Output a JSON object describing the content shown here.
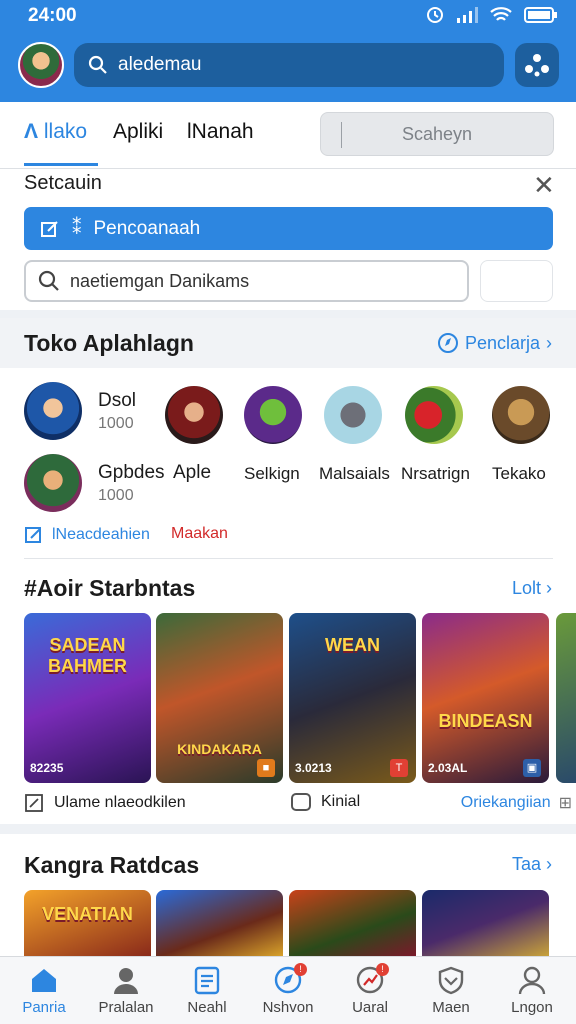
{
  "status_bar": {
    "time": "24:00"
  },
  "header": {
    "search_value": "aledemau"
  },
  "tabs": [
    {
      "label": "llako"
    },
    {
      "label": "Apliki"
    },
    {
      "label": "lNanah"
    }
  ],
  "tab_search_placeholder": "Scaheyn",
  "panel": {
    "title": "Setcauin",
    "primary_button": "Pencoanaah",
    "search_value": "naetiemgan Danikams"
  },
  "section_store": {
    "title": "Toko Aplahlagn",
    "link": "Penclarja",
    "apps_row1": [
      {
        "name": "Dsol",
        "count": "1000"
      }
    ],
    "apps_row2": [
      {
        "name": "Gpbdes",
        "count": "1000"
      },
      {
        "name": "Aple"
      },
      {
        "name": "Selkign"
      },
      {
        "name": "Malsaials"
      },
      {
        "name": "Nrsatrign"
      },
      {
        "name": "Tekako"
      }
    ],
    "footer_left": "lNeacdeahien",
    "footer_right": "Maakan"
  },
  "section_star": {
    "title": "#Aoir Starbntas",
    "link": "Lolt",
    "tiles": [
      {
        "art": "SADEAN BAHMER",
        "caption": "82235"
      },
      {
        "art": "KINDAKARA",
        "caption": ""
      },
      {
        "art": "WEAN",
        "caption": "3.0213"
      },
      {
        "art": "BINDEASN",
        "caption": "2.03AL"
      }
    ],
    "footer_left": "Ulame nlaeodkilen",
    "footer_mid": "Kinial",
    "footer_right": "Oriekangiian"
  },
  "section_rating": {
    "title": "Kangra Ratdcas",
    "link": "Taa",
    "tiles": [
      {
        "art": "VENATIAN"
      },
      {
        "art": ""
      },
      {
        "art": ""
      },
      {
        "art": ""
      }
    ]
  },
  "bottom_nav": [
    {
      "label": "Panria"
    },
    {
      "label": "Pralalan"
    },
    {
      "label": "Neahl"
    },
    {
      "label": "Nshvon"
    },
    {
      "label": "Uaral"
    },
    {
      "label": "Maen"
    },
    {
      "label": "Lngon"
    }
  ],
  "colors": {
    "accent": "#2d86e0",
    "header_dark": "#1d5f9e",
    "badge": "#e14034"
  }
}
